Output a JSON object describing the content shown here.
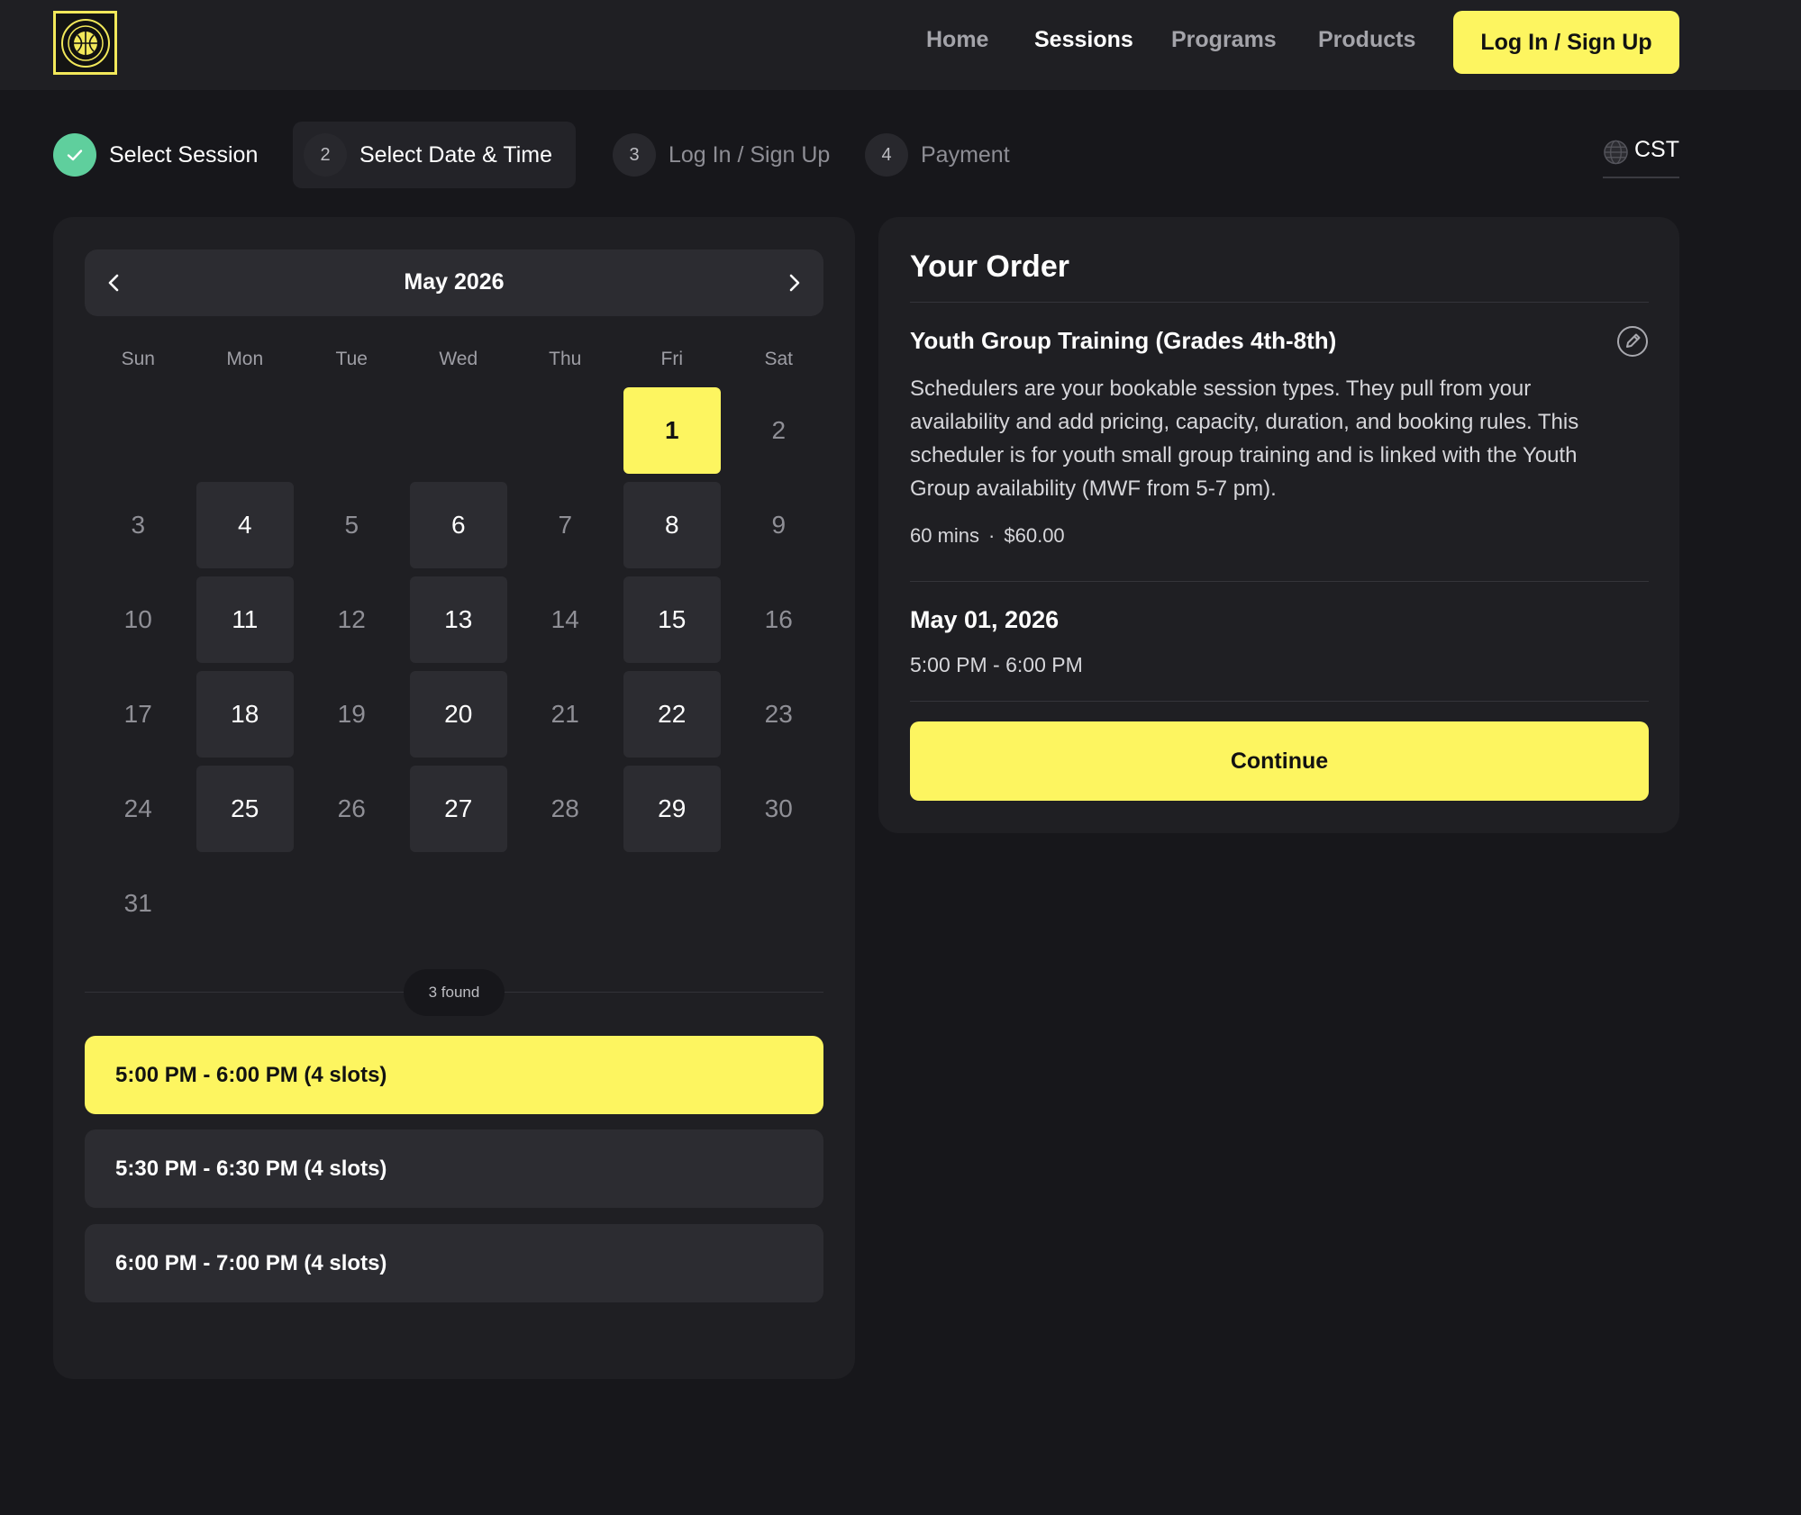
{
  "nav": {
    "links": [
      "Home",
      "Sessions",
      "Programs",
      "Products"
    ],
    "active": "Sessions",
    "login_label": "Log In / Sign Up"
  },
  "stepper": {
    "steps": [
      {
        "number": "",
        "label": "Select Session",
        "state": "done"
      },
      {
        "number": "2",
        "label": "Select Date & Time",
        "state": "active"
      },
      {
        "number": "3",
        "label": "Log In / Sign Up",
        "state": "upcoming"
      },
      {
        "number": "4",
        "label": "Payment",
        "state": "upcoming"
      }
    ],
    "timezone": "CST"
  },
  "calendar": {
    "month_label": "May 2026",
    "weekdays": [
      "Sun",
      "Mon",
      "Tue",
      "Wed",
      "Thu",
      "Fri",
      "Sat"
    ],
    "first_weekday_index": 5,
    "days_in_month": 31,
    "available_days": [
      1,
      4,
      6,
      8,
      11,
      13,
      15,
      18,
      20,
      22,
      25,
      27,
      29
    ],
    "selected_day": 1,
    "found_label": "3 found",
    "slots": [
      {
        "label": "5:00 PM - 6:00 PM (4 slots)",
        "selected": true
      },
      {
        "label": "5:30 PM - 6:30 PM (4 slots)",
        "selected": false
      },
      {
        "label": "6:00 PM - 7:00 PM (4 slots)",
        "selected": false
      }
    ]
  },
  "order": {
    "title": "Your Order",
    "item_name": "Youth Group Training (Grades 4th-8th)",
    "description": "Schedulers are your bookable session types. They pull from your availability and add pricing, capacity, duration, and booking rules. This scheduler is for youth small group training and is linked with the Youth Group availability (MWF from 5-7 pm).",
    "duration": "60 mins",
    "separator": "·",
    "price": "$60.00",
    "selected_date": "May 01, 2026",
    "selected_time": "5:00 PM - 6:00 PM",
    "continue_label": "Continue"
  },
  "colors": {
    "background": "#17171b",
    "card": "#1f1f23",
    "accent": "#fdf560",
    "success": "#5fcf9d",
    "tile": "#2c2c31"
  }
}
